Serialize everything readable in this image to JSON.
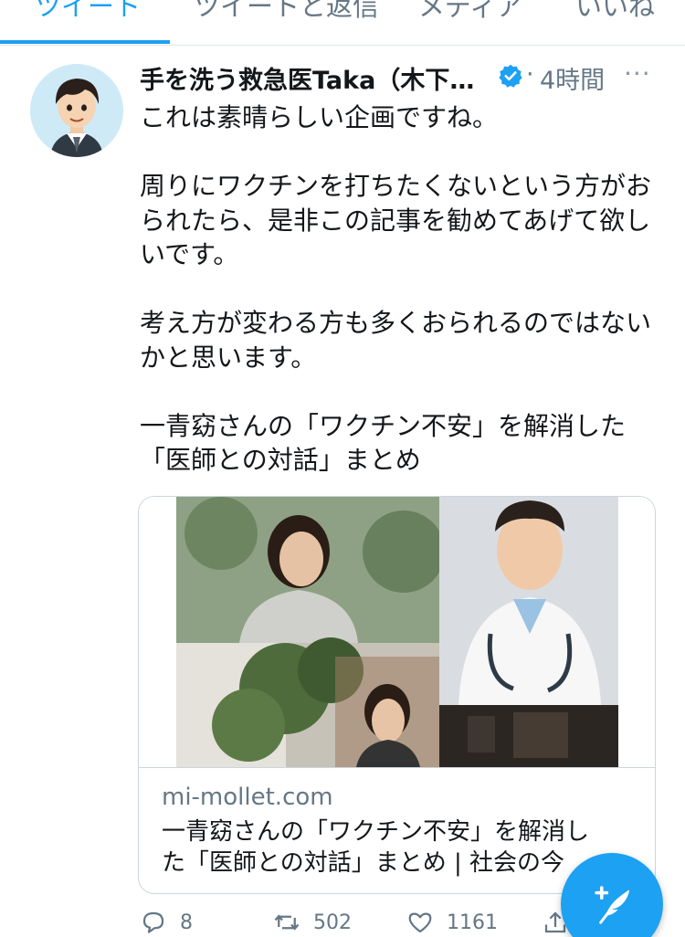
{
  "tabs": [
    {
      "label": "ツイート",
      "active": true
    },
    {
      "label": "ツイートと返信",
      "active": false
    },
    {
      "label": "メディア",
      "active": false
    },
    {
      "label": "いいね",
      "active": false
    }
  ],
  "tweet": {
    "author_name": "手を洗う救急医Taka（木下…",
    "verified": true,
    "separator": "·",
    "time": "4時間",
    "more_label": "···",
    "text": {
      "line1": "これは素晴らしい企画ですね。",
      "line2": "周りにワクチンを打ちたくないという方がお",
      "line3": "られたら、是非この記事を勧めてあげて欲し",
      "line4": "いです。",
      "line5": "考え方が変わる方も多くおられるのではない",
      "line6": "かと思います。",
      "line7": "一青窈さんの「ワクチン不安」を解消した",
      "line8": "「医師との対話」まとめ"
    },
    "card": {
      "domain": "mi-mollet.com",
      "title_line1": "一青窈さんの「ワクチン不安」を解消し",
      "title_line2": "た「医師との対話」まとめ | 社会の今"
    },
    "actions": {
      "reply_count": "8",
      "retweet_count": "502",
      "like_count": "1161"
    }
  },
  "colors": {
    "accent": "#1da1f2",
    "text": "#14171a",
    "secondary": "#657786"
  },
  "icons": [
    "verified-badge-icon",
    "more-icon",
    "reply-icon",
    "retweet-icon",
    "like-icon",
    "share-icon",
    "compose-tweet-icon"
  ]
}
